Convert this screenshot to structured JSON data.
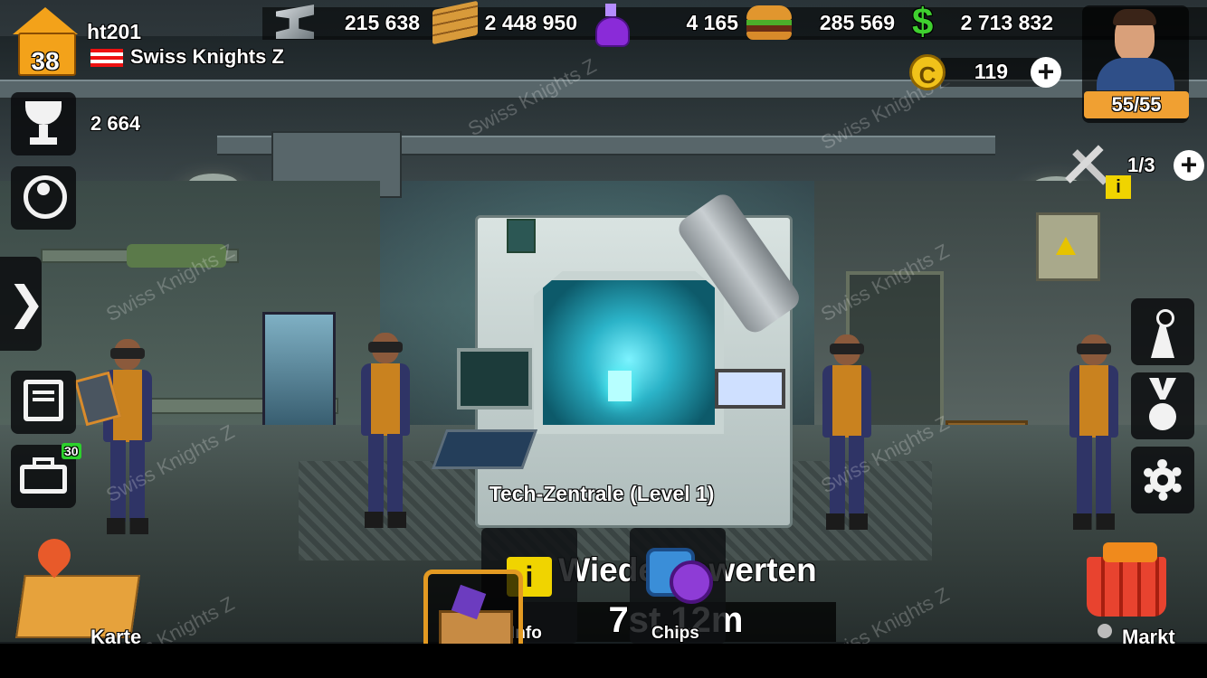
{
  "player": {
    "name": "ht201",
    "level": "38",
    "clan": "Swiss Knights Z",
    "trophies": "2 664"
  },
  "resources": [
    {
      "icon": "steel-beam-icon",
      "value": "215 638"
    },
    {
      "icon": "wood-planks-icon",
      "value": "2 448 950"
    },
    {
      "icon": "potion-flask-icon",
      "value": "4 165"
    },
    {
      "icon": "burger-icon",
      "value": "285 569"
    },
    {
      "icon": "dollar-icon",
      "value": "2 713 832"
    }
  ],
  "coins": {
    "value": "119",
    "plus": "+"
  },
  "hero": {
    "energy": "55/55"
  },
  "builders": {
    "value": "1/3",
    "plus": "+"
  },
  "building": {
    "title": "Tech-Zentrale (Level 1)",
    "action": "Wiederbewerten",
    "timer": "7st 12m"
  },
  "actions": {
    "info": "Info",
    "chips": "Chips"
  },
  "nav": {
    "map": "Karte",
    "market": "Markt",
    "toolbox_badge": "30",
    "side_arrow": "❯"
  },
  "watermark": "Swiss Knights Z",
  "colors": {
    "level_house": "#f3a21a",
    "energy_bar": "#f0a032",
    "market_cart": "#e8432f",
    "info_yellow": "#f0d400",
    "badge_green": "#2cd12c"
  }
}
